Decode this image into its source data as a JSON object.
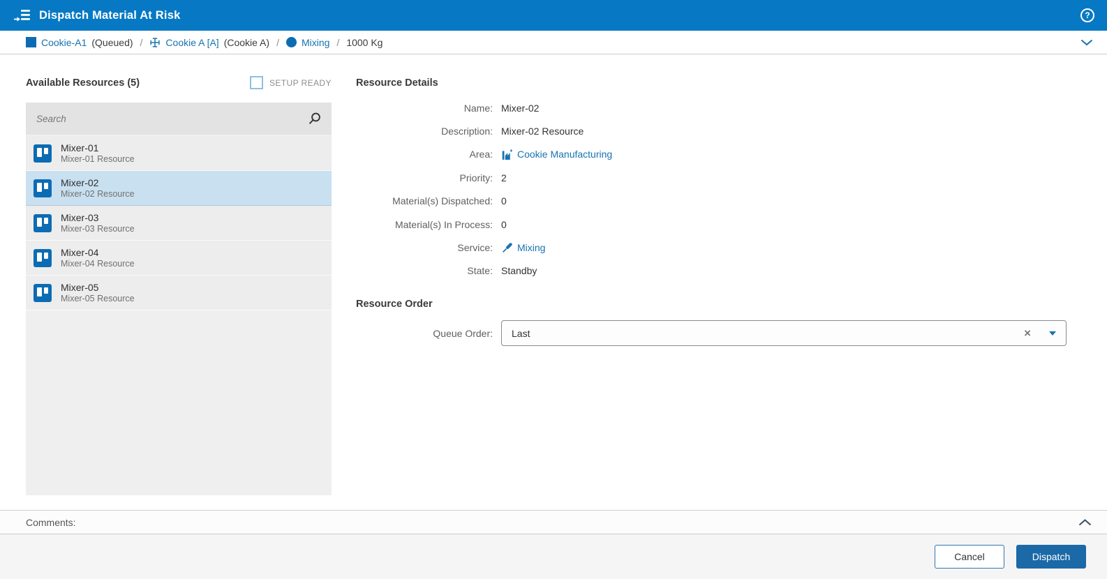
{
  "titlebar": {
    "title": "Dispatch Material At Risk"
  },
  "breadcrumb": {
    "separator": "/",
    "lot": {
      "label": "Cookie-A1",
      "status": "(Queued)"
    },
    "step": {
      "label": "Cookie A [A]",
      "status": "(Cookie A)"
    },
    "service": {
      "label": "Mixing"
    },
    "quantity": "1000 Kg"
  },
  "resources": {
    "title": "Available Resources (5)",
    "setup_ready_label": "SETUP READY",
    "search_placeholder": "Search",
    "selected_index": 1,
    "items": [
      {
        "name": "Mixer-01",
        "description": "Mixer-01 Resource"
      },
      {
        "name": "Mixer-02",
        "description": "Mixer-02 Resource"
      },
      {
        "name": "Mixer-03",
        "description": "Mixer-03 Resource"
      },
      {
        "name": "Mixer-04",
        "description": "Mixer-04 Resource"
      },
      {
        "name": "Mixer-05",
        "description": "Mixer-05 Resource"
      }
    ]
  },
  "details": {
    "title": "Resource Details",
    "name": {
      "label": "Name:",
      "value": "Mixer-02"
    },
    "description": {
      "label": "Description:",
      "value": "Mixer-02 Resource"
    },
    "area": {
      "label": "Area:",
      "value": "Cookie Manufacturing",
      "icon": "factory-icon"
    },
    "priority": {
      "label": "Priority:",
      "value": "2"
    },
    "materials_dispatched": {
      "label": "Material(s) Dispatched:",
      "value": "0"
    },
    "materials_in_process": {
      "label": "Material(s) In Process:",
      "value": "0"
    },
    "service": {
      "label": "Service:",
      "value": "Mixing",
      "icon": "tool-icon"
    },
    "state": {
      "label": "State:",
      "value": "Standby"
    }
  },
  "order": {
    "title": "Resource Order",
    "queue": {
      "label": "Queue Order:",
      "value": "Last"
    }
  },
  "comments": {
    "label": "Comments:"
  },
  "footer": {
    "cancel_label": "Cancel",
    "dispatch_label": "Dispatch"
  },
  "icons": {
    "help": "?",
    "clear": "×"
  },
  "colors": {
    "header_blue": "#0779c4",
    "link_blue": "#1673b1",
    "icon_blue": "#0c6cb3",
    "selected_row": "#c9e0f1",
    "row_gray": "#ededed",
    "dispatch_button": "#1b69a6",
    "footer_gray": "#f5f5f5"
  }
}
